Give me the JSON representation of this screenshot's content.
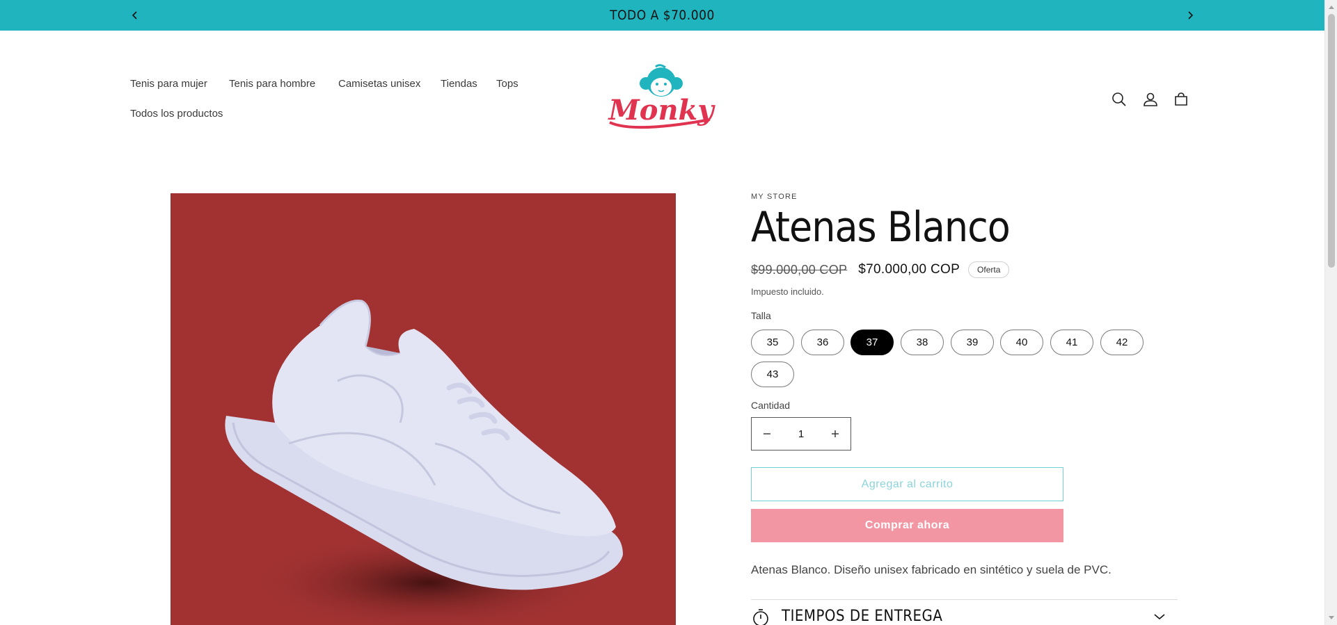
{
  "announcement": {
    "text": "TODO A $70.000"
  },
  "colors": {
    "announcement_bg": "#20b4bf",
    "media_bg": "#a23232",
    "buy_now_bg": "#f396a4",
    "add_cart_border": "#6fd0d8",
    "logo_red": "#e0334f",
    "logo_teal": "#20b4bf"
  },
  "nav": {
    "items": [
      {
        "label": "Tenis para mujer"
      },
      {
        "label": "Tenis para hombre"
      },
      {
        "label": "Camisetas unisex"
      },
      {
        "label": "Tiendas"
      },
      {
        "label": "Tops"
      },
      {
        "label": "Todos los productos"
      }
    ]
  },
  "logo": {
    "text": "Monky"
  },
  "header_icons": [
    "search-icon",
    "account-icon",
    "cart-icon"
  ],
  "product": {
    "vendor": "MY STORE",
    "title": "Atenas Blanco",
    "price_regular": "$99.000,00 COP",
    "price_sale": "$70.000,00 COP",
    "badge": "Oferta",
    "tax_note": "Impuesto incluido.",
    "size_label": "Talla",
    "sizes": [
      "35",
      "36",
      "37",
      "38",
      "39",
      "40",
      "41",
      "42",
      "43"
    ],
    "selected_size": "37",
    "quantity_label": "Cantidad",
    "quantity": "1",
    "add_to_cart": "Agregar al carrito",
    "buy_now": "Comprar ahora",
    "description": "Atenas Blanco. Diseño unisex fabricado en sintético y suela de PVC.",
    "accordion_title": "TIEMPOS DE ENTREGA"
  }
}
